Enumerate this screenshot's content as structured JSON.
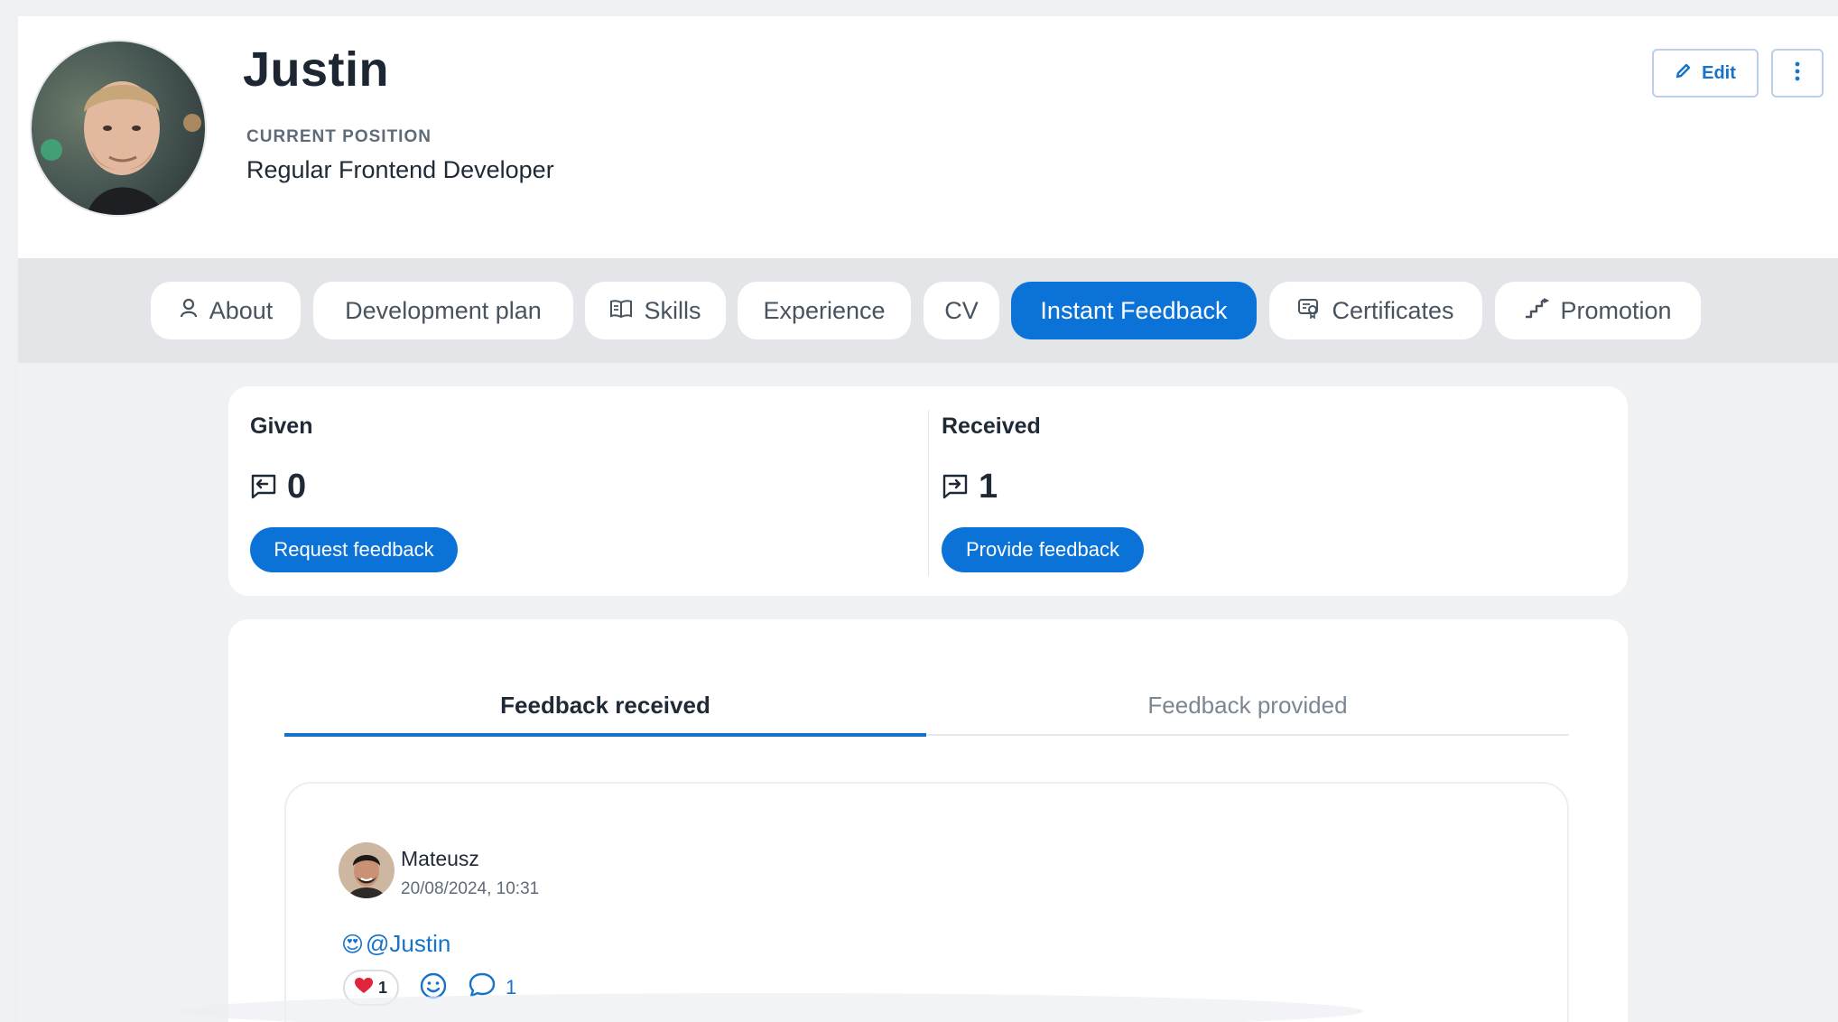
{
  "profile": {
    "name": "Justin",
    "position_label": "CURRENT POSITION",
    "position_value": "Regular Frontend Developer",
    "edit_label": "Edit"
  },
  "tabs": [
    {
      "label": "About",
      "icon": "user-icon"
    },
    {
      "label": "Development plan",
      "icon": ""
    },
    {
      "label": "Skills",
      "icon": "book-icon"
    },
    {
      "label": "Experience",
      "icon": ""
    },
    {
      "label": "CV",
      "icon": ""
    },
    {
      "label": "Instant Feedback",
      "icon": "",
      "active": true
    },
    {
      "label": "Certificates",
      "icon": "certificate-icon"
    },
    {
      "label": "Promotion",
      "icon": "stairs-icon"
    }
  ],
  "stats": {
    "given": {
      "title": "Given",
      "count": "0",
      "button": "Request feedback"
    },
    "received": {
      "title": "Received",
      "count": "1",
      "button": "Provide feedback"
    }
  },
  "feed": {
    "tabs": [
      {
        "label": "Feedback received",
        "active": true
      },
      {
        "label": "Feedback provided",
        "active": false
      }
    ],
    "items": [
      {
        "author": "Mateusz",
        "timestamp": "20/08/2024, 10:31",
        "message_emoji": "😍",
        "message_mention": "@Justin",
        "reaction_count": "1",
        "comment_count": "1"
      }
    ]
  },
  "colors": {
    "primary": "#0b73d8",
    "link": "#1673c9",
    "background": "#f0f1f3"
  }
}
